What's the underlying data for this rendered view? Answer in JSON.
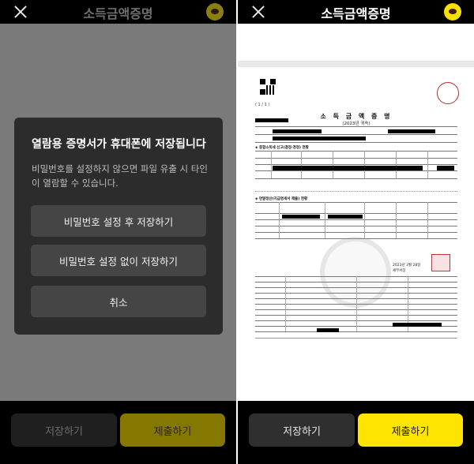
{
  "left": {
    "header": {
      "title": "소득금액증명"
    },
    "dialog": {
      "title": "열람용 증명서가 휴대폰에 저장됩니다",
      "body": "비밀번호를 설정하지 않으면 파일 유출 시 타인이 열람할 수 있습니다.",
      "buttons": [
        "비밀번호 설정 후 저장하기",
        "비밀번호 설정 없이 저장하기",
        "취소"
      ]
    },
    "footer": {
      "save_label": "저장하기",
      "submit_label": "제출하기"
    }
  },
  "right": {
    "header": {
      "title": "소득금액증명"
    },
    "document": {
      "page": "( 1 / 1 )",
      "title": "소 득 금 액 증 명",
      "subtitle": "(2023년 귀속)",
      "section1": "◈ 종합소득세 신고(결정·경정) 현황",
      "section2": "◈ 연말정산(지급명세서 제출) 현황",
      "date": "2023년 3월 28일",
      "issuer": "세무서장"
    },
    "footer": {
      "save_label": "저장하기",
      "submit_label": "제출하기"
    }
  },
  "colors": {
    "accent": "#ffe400",
    "dialog_bg": "#2c2c2c",
    "dialog_button": "#454545"
  },
  "icons": {
    "close": "close-icon",
    "talk": "kakaotalk-icon"
  }
}
